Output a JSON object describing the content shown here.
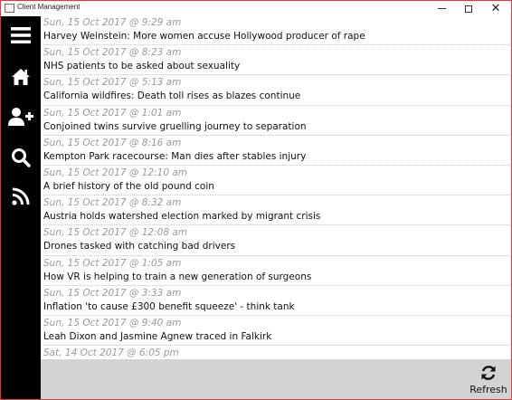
{
  "window": {
    "title": "Client Management",
    "controls": {
      "minimize": "",
      "maximize": "",
      "close": "✕"
    }
  },
  "sidebar": {
    "items": [
      {
        "icon": "hamburger-menu-icon"
      },
      {
        "icon": "home-icon"
      },
      {
        "icon": "add-user-icon"
      },
      {
        "icon": "search-icon"
      },
      {
        "icon": "rss-feed-icon"
      }
    ]
  },
  "feed": {
    "items": [
      {
        "date": "Sun, 15 Oct 2017 @ 9:29 am",
        "headline": "Harvey Weinstein: More women accuse Hollywood producer of rape"
      },
      {
        "date": "Sun, 15 Oct 2017 @ 8:23 am",
        "headline": "NHS patients to be asked about sexuality"
      },
      {
        "date": "Sun, 15 Oct 2017 @ 5:13 am",
        "headline": "California wildfires: Death toll rises as blazes continue"
      },
      {
        "date": "Sun, 15 Oct 2017 @ 1:01 am",
        "headline": "Conjoined twins survive gruelling journey to separation"
      },
      {
        "date": "Sun, 15 Oct 2017 @ 8:16 am",
        "headline": "Kempton Park racecourse: Man dies after stables injury"
      },
      {
        "date": "Sun, 15 Oct 2017 @ 12:10 am",
        "headline": "A brief history of the old pound coin"
      },
      {
        "date": "Sun, 15 Oct 2017 @ 8:32 am",
        "headline": "Austria holds watershed election marked by migrant crisis"
      },
      {
        "date": "Sun, 15 Oct 2017 @ 12:08 am",
        "headline": "Drones tasked with catching bad drivers"
      },
      {
        "date": "Sun, 15 Oct 2017 @ 1:05 am",
        "headline": "How VR is helping to train a new generation of surgeons"
      },
      {
        "date": "Sun, 15 Oct 2017 @ 3:33 am",
        "headline": "Inflation 'to cause £300 benefit squeeze' - think tank"
      },
      {
        "date": "Sun, 15 Oct 2017 @ 9:40 am",
        "headline": "Leah Dixon and Jasmine Agnew traced in Falkirk"
      },
      {
        "date": "Sat, 14 Oct 2017 @ 6:05 pm",
        "headline": ""
      }
    ]
  },
  "bottombar": {
    "refresh_label": "Refresh",
    "refresh_icon": "refresh-icon"
  },
  "colors": {
    "sidebar_bg": "#000000",
    "bottombar_bg": "#d3d3d3",
    "date_text": "#9a9a9a",
    "headline_text": "#111111",
    "window_border": "#e03a3a"
  }
}
